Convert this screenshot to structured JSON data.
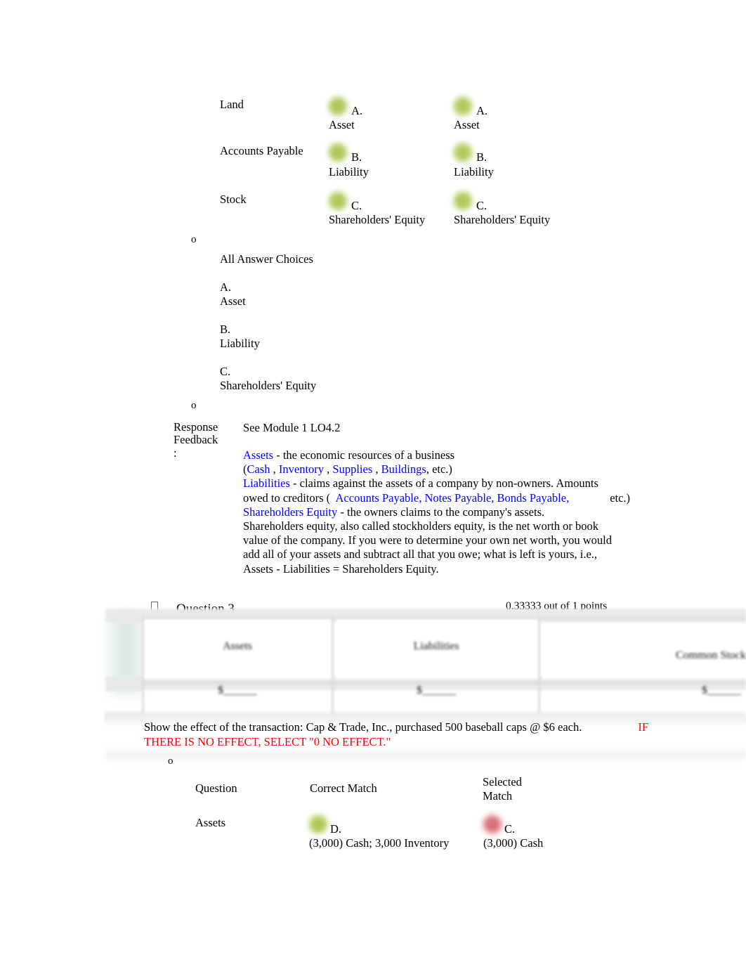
{
  "top_match_block": {
    "rows": [
      {
        "term": "Land",
        "correct_match": {
          "marker": "green-dot",
          "letter": "A.",
          "text": "Asset"
        },
        "selected_match": {
          "marker": "green-dot",
          "letter": "A.",
          "text": "Asset"
        }
      },
      {
        "term": "Accounts Payable",
        "correct_match": {
          "marker": "green-dot",
          "letter": "B.",
          "text": "Liability"
        },
        "selected_match": {
          "marker": "green-dot",
          "letter": "B.",
          "text": "Liability"
        }
      },
      {
        "term": "Stock",
        "correct_match": {
          "marker": "green-dot",
          "letter": "C.",
          "text": "Shareholders' Equity"
        },
        "selected_match": {
          "marker": "green-dot",
          "letter": "C.",
          "text": "Shareholders' Equity"
        }
      }
    ]
  },
  "bullets": {
    "glyph": "o"
  },
  "all_answer_choices": {
    "heading": "All Answer Choices",
    "items": [
      {
        "letter": "A.",
        "text": "Asset"
      },
      {
        "letter": "B.",
        "text": "Liability"
      },
      {
        "letter": "C.",
        "text": "Shareholders' Equity"
      }
    ]
  },
  "response_feedback": {
    "label_line1": "Response",
    "label_line2": "Feedback",
    "label_line3": ":",
    "reference": "See Module 1 LO4.2",
    "assets_term": "Assets",
    "assets_def": "  - the economic resources of a business",
    "assets_examples_open": "(",
    "assets_examples": [
      "Cash",
      "Inventory",
      "Supplies",
      "Buildings"
    ],
    "assets_examples_close": ", etc.)",
    "liabilities_term": "Liabilities",
    "liabilities_def": " - claims against the assets of a company by non-owners. Amounts",
    "liabilities_line2_pre": "owed to creditors (",
    "liabilities_examples": "Accounts Payable, Notes Payable, Bonds Payable,",
    "liabilities_line2_post": "etc.)",
    "equity_term": "Shareholders Equity",
    "equity_def": "   - the owners claims to the company's assets.",
    "equity_body_line1": "Shareholders equity, also called stockholders equity, is the net worth or book",
    "equity_body_line2": "value of the company. If you were to determine your own net worth, you would",
    "equity_body_line3": "add all of your assets and subtract all that you owe; what is left is yours, i.e.,",
    "equity_body_line4": "Assets - Liabilities = Shareholders Equity."
  },
  "question3": {
    "title": "Question 3",
    "score": "0.33333 out of 1 points",
    "table": {
      "headers": [
        "Assets",
        "Liabilities",
        "Common Stock"
      ],
      "values": [
        "$______",
        "$______",
        "$______"
      ]
    },
    "statement_black": "Show the effect of the transaction: Cap & Trade, Inc., purchased 500 baseball caps @ $6 each.",
    "statement_red_inline": "IF",
    "statement_red_line2": "THERE IS NO EFFECT, SELECT \"0 NO EFFECT.\"",
    "match_grid": {
      "col_question": "Question",
      "col_correct": "Correct Match",
      "col_selected_line1": "Selected",
      "col_selected_line2": "Match",
      "rows": [
        {
          "question": "Assets",
          "correct": {
            "marker": "green-dot",
            "letter": "D.",
            "text": "(3,000) Cash; 3,000 Inventory"
          },
          "selected": {
            "marker": "red-dot",
            "letter": "C.",
            "text": "(3,000) Cash"
          }
        }
      ]
    }
  },
  "colors": {
    "link_blue": "#0000ff",
    "alert_red": "#fe0000",
    "correct_marker": "#a8c44a",
    "incorrect_marker": "#d4646c"
  }
}
